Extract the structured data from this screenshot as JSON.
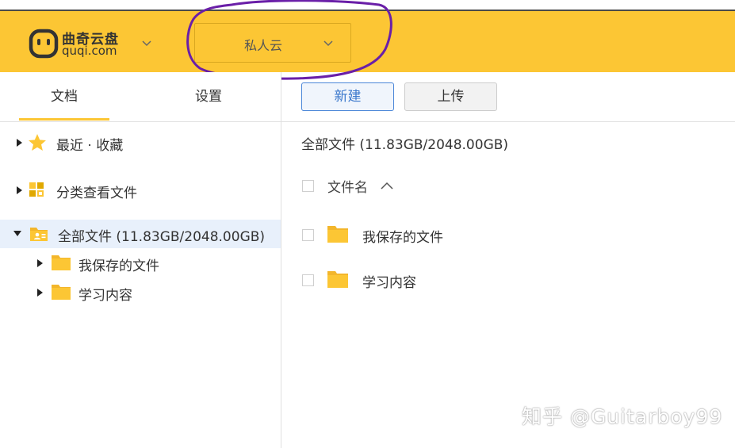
{
  "brand": {
    "name": "曲奇云盘",
    "url": "quqi.com",
    "icon": "quqi-logo-icon",
    "accent_color": "#fcc634"
  },
  "header": {
    "space_selector": {
      "selected": "私人云",
      "icon": "chevron-down-icon"
    },
    "annotation_color": "#6a1fa8"
  },
  "sidebar": {
    "tabs": [
      {
        "label": "文档",
        "active": true
      },
      {
        "label": "设置",
        "active": false
      }
    ],
    "tree": [
      {
        "label": "最近 · 收藏",
        "icon": "star-icon",
        "expanded": false
      },
      {
        "label": "分类查看文件",
        "icon": "category-grid-icon",
        "expanded": false
      },
      {
        "label": "全部文件 (11.83GB/2048.00GB)",
        "icon": "folder-shared-icon",
        "expanded": true,
        "selected": true,
        "children": [
          {
            "label": "我保存的文件",
            "icon": "folder-icon"
          },
          {
            "label": "学习内容",
            "icon": "folder-icon"
          }
        ]
      }
    ]
  },
  "main": {
    "toolbar": {
      "new_label": "新建",
      "upload_label": "上传"
    },
    "breadcrumb": "全部文件 (11.83GB/2048.00GB)",
    "columns": {
      "name": "文件名",
      "sort_icon": "sort-asc-icon"
    },
    "files": [
      {
        "name": "我保存的文件",
        "icon": "folder-icon"
      },
      {
        "name": "学习内容",
        "icon": "folder-icon"
      }
    ]
  },
  "watermark": "知乎 @Guitarboy99"
}
